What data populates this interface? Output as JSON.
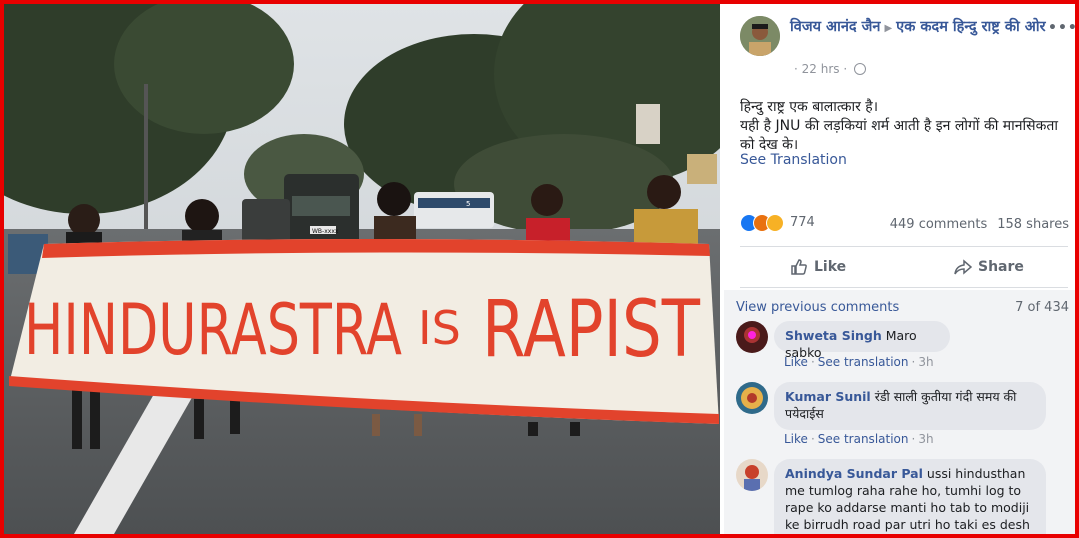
{
  "post": {
    "author": "विजय आनंद जैन",
    "group": "एक कदम हिन्दु राष्ट्र की ओर",
    "time": "22 hrs",
    "more_label": "•••",
    "text_line1": "हिन्दु राष्ट्र एक बालात्कार है।",
    "text_line2": "यही है JNU की लड़कियां शर्म आती है इन लोगों की मानसिकता को देख के।",
    "see_translation": "See Translation",
    "reaction_count": "774",
    "comments_count": "449 comments",
    "shares_count": "158 shares",
    "like_label": "Like",
    "share_label": "Share"
  },
  "photo": {
    "banner_text_1": "HINDURASTRA",
    "banner_text_2": "IS",
    "banner_text_3": "RAPIST",
    "bus_sign": "5",
    "truck_plate": "WB-xxxx"
  },
  "comments": {
    "view_previous": "View previous comments",
    "pager": "7 of 434",
    "items": [
      {
        "name": "Shweta Singh",
        "text": "Maro sabko",
        "like": "Like",
        "see_translation": "See translation",
        "time": "3h"
      },
      {
        "name": "Kumar Sunil",
        "text": "रंडी साली कुतीया गंदी समय की पयेदाईस",
        "like": "Like",
        "see_translation": "See translation",
        "time": "3h"
      },
      {
        "name": "Anindya Sundar Pal",
        "text": "ussi hindusthan me tumlog raha rahe ho, tumhi log to rape ko addarse manti ho tab to modiji ke birrudh road par utri ho taki es desh me curruption barkatar rahe"
      }
    ]
  },
  "colors": {
    "frame": "#e80000",
    "link": "#385898",
    "banner_red": "#e2432c",
    "like_blue": "#1877f2"
  }
}
